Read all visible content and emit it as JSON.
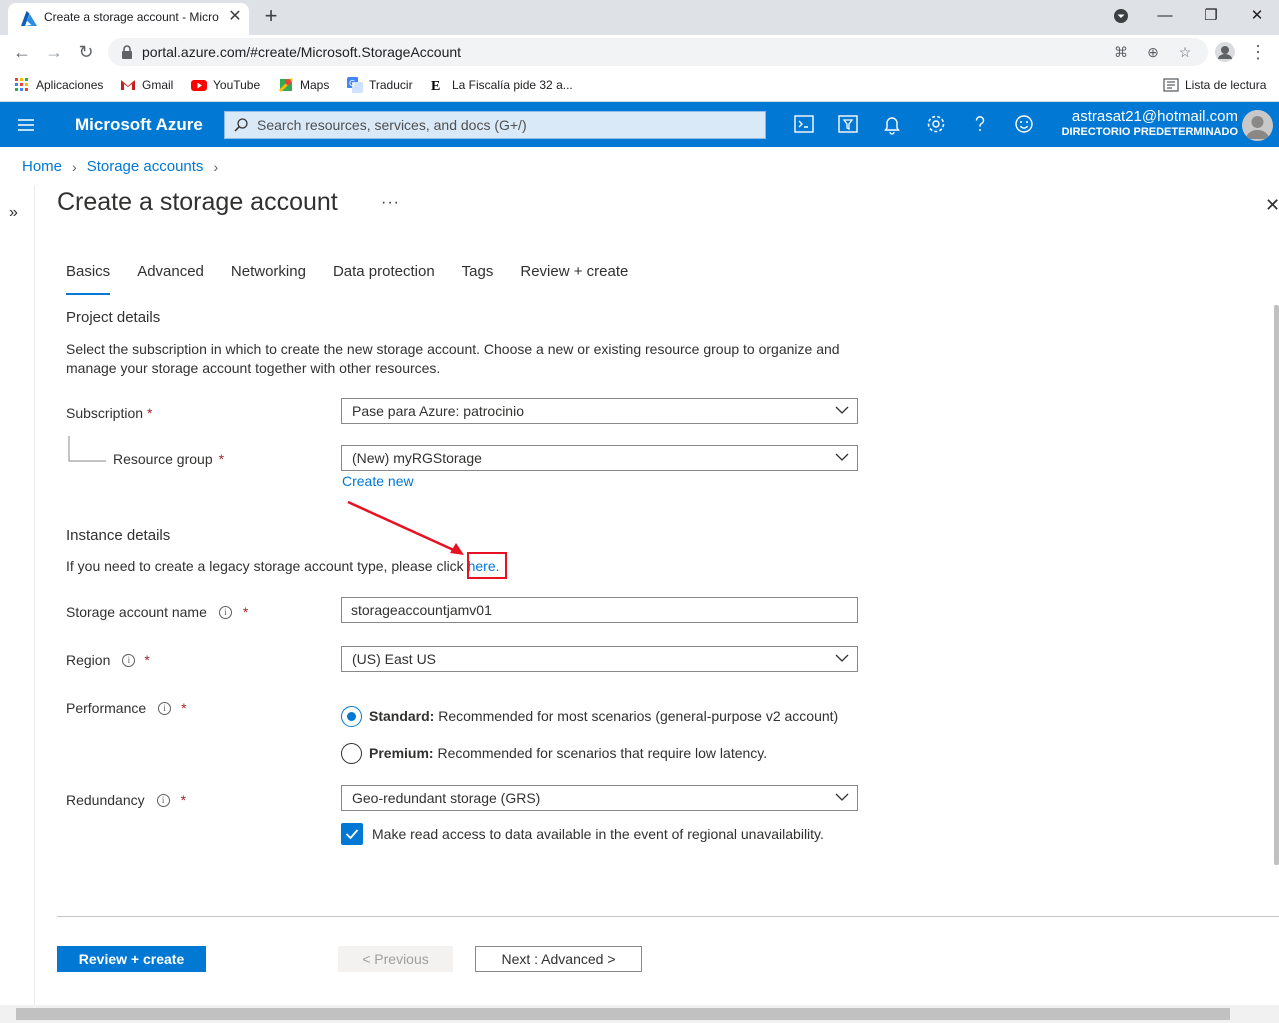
{
  "browser": {
    "tab_title": "Create a storage account - Micro",
    "url": "portal.azure.com/#create/Microsoft.StorageAccount",
    "bookmarks": [
      {
        "label": "Aplicaciones",
        "icon": "apps-grid-icon",
        "color": "#ea4335"
      },
      {
        "label": "Gmail",
        "icon": "gmail-icon",
        "color": "#c5221f"
      },
      {
        "label": "YouTube",
        "icon": "youtube-icon",
        "color": "#ff0000"
      },
      {
        "label": "Maps",
        "icon": "maps-icon",
        "color": "#34a853"
      },
      {
        "label": "Traducir",
        "icon": "translate-icon",
        "color": "#4285f4"
      },
      {
        "label": "La Fiscalía pide 32 a...",
        "icon": "el-pais-icon",
        "color": "#000000"
      }
    ],
    "reading_list": "Lista de lectura"
  },
  "azure": {
    "brand": "Microsoft Azure",
    "search_placeholder": "Search resources, services, and docs (G+/)",
    "account_email": "astrasat21@hotmail.com",
    "account_directory": "DIRECTORIO PREDETERMINADO",
    "accent": "#0078d4"
  },
  "breadcrumb": [
    "Home",
    "Storage accounts"
  ],
  "page_title": "Create a storage account",
  "tabs": [
    "Basics",
    "Advanced",
    "Networking",
    "Data protection",
    "Tags",
    "Review + create"
  ],
  "active_tab": "Basics",
  "project": {
    "heading": "Project details",
    "description_line1": "Select the subscription in which to create the new storage account. Choose a new or existing resource group to organize and",
    "description_line2": "manage your storage account together with other resources.",
    "subscription_label": "Subscription",
    "subscription_value": "Pase para Azure: patrocinio",
    "resource_group_label": "Resource group",
    "resource_group_value": "(New) myRGStorage",
    "create_new": "Create new"
  },
  "instance": {
    "heading": "Instance details",
    "legacy_text": "If you need to create a legacy storage account type, please click ",
    "legacy_link": "here.",
    "name_label": "Storage account name",
    "name_value": "storageaccountjamv01",
    "region_label": "Region",
    "region_value": "(US) East US",
    "performance_label": "Performance",
    "perf_standard_bold": "Standard:",
    "perf_standard_desc": " Recommended for most scenarios (general-purpose v2 account)",
    "perf_premium_bold": "Premium:",
    "perf_premium_desc": " Recommended for scenarios that require low latency.",
    "redundancy_label": "Redundancy",
    "redundancy_value": "Geo-redundant storage (GRS)",
    "read_access": "Make read access to data available in the event of regional unavailability."
  },
  "footer": {
    "review_create": "Review + create",
    "previous": "< Previous",
    "next": "Next : Advanced >"
  },
  "required_mark": "*",
  "info_mark": "i"
}
